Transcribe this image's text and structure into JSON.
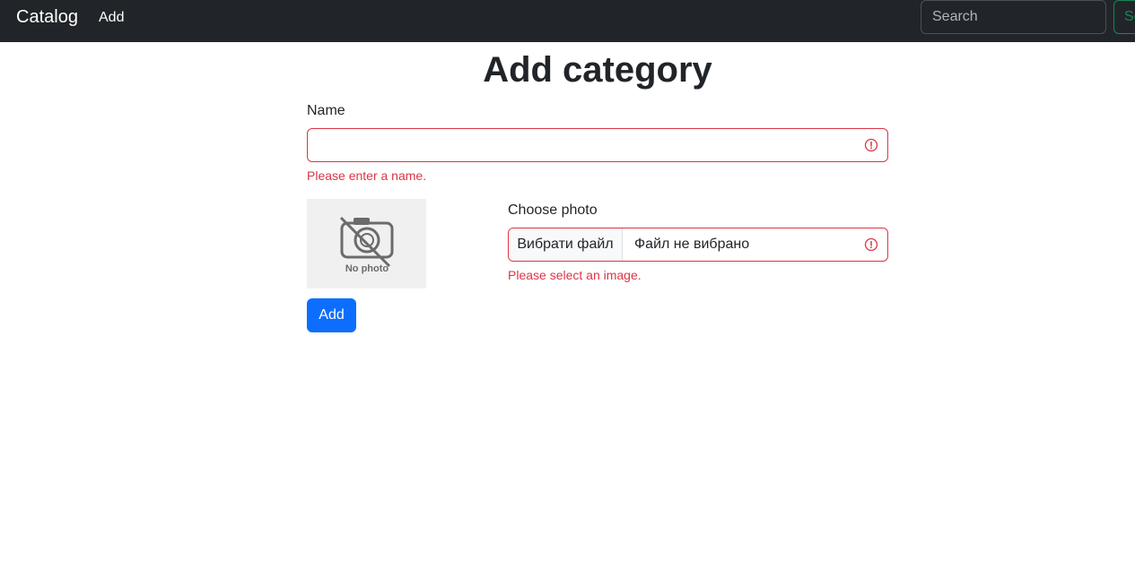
{
  "navbar": {
    "brand": "Catalog",
    "links": [
      {
        "label": "Add"
      }
    ],
    "search_placeholder": "Search",
    "search_button_label": "Se"
  },
  "page": {
    "title": "Add category"
  },
  "form": {
    "name_label": "Name",
    "name_value": "",
    "name_error": "Please enter a name.",
    "photo_label": "Choose photo",
    "photo_placeholder_text": "No photo",
    "file_button_label": "Вибрати файл",
    "file_status": "Файл не вибрано",
    "photo_error": "Please select an image.",
    "submit_label": "Add"
  },
  "colors": {
    "navbar_bg": "#212529",
    "error": "#dc3545",
    "primary": "#0d6efd",
    "success": "#198754"
  },
  "icons": {
    "invalid": "exclamation-circle-icon",
    "no_photo": "camera-off-icon"
  }
}
